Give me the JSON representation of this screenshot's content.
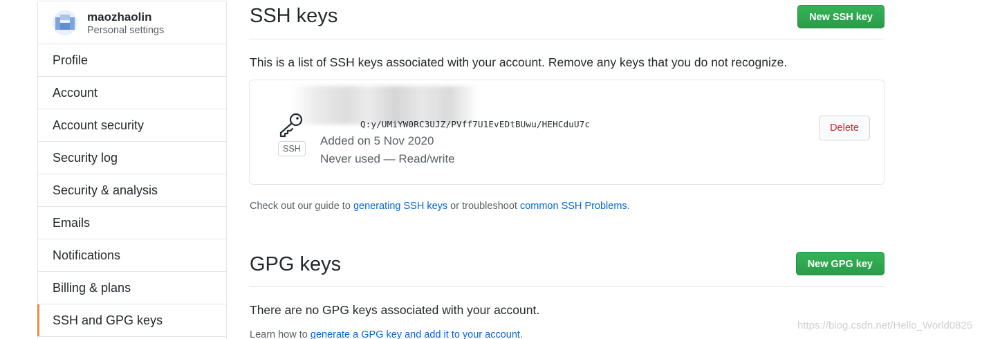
{
  "sidebar": {
    "user": {
      "name": "maozhaolin",
      "subtitle": "Personal settings"
    },
    "items": [
      {
        "label": "Profile",
        "selected": false
      },
      {
        "label": "Account",
        "selected": false
      },
      {
        "label": "Account security",
        "selected": false
      },
      {
        "label": "Security log",
        "selected": false
      },
      {
        "label": "Security & analysis",
        "selected": false
      },
      {
        "label": "Emails",
        "selected": false
      },
      {
        "label": "Notifications",
        "selected": false
      },
      {
        "label": "Billing & plans",
        "selected": false
      },
      {
        "label": "SSH and GPG keys",
        "selected": true
      }
    ]
  },
  "ssh": {
    "title": "SSH keys",
    "new_button": "New SSH key",
    "intro": "This is a list of SSH keys associated with your account. Remove any keys that you do not recognize.",
    "key": {
      "type_badge": "SSH",
      "fingerprint": "Q:y/UMiYW0RC3UJZ/PVff7U1EvEDtBUwu/HEHCduU7c",
      "added": "Added on 5 Nov 2020",
      "usage": "Never used — Read/write",
      "delete_label": "Delete"
    },
    "guide": {
      "prefix": "Check out our guide to ",
      "link1": "generating SSH keys",
      "middle": " or troubleshoot ",
      "link2": "common SSH Problems",
      "suffix": "."
    }
  },
  "gpg": {
    "title": "GPG keys",
    "new_button": "New GPG key",
    "empty": "There are no GPG keys associated with your account.",
    "learn": {
      "prefix": "Learn how to ",
      "link": "generate a GPG key and add it to your account",
      "suffix": "."
    }
  },
  "watermark": "https://blog.csdn.net/Hello_World0825",
  "colors": {
    "accent_green": "#2ea44f",
    "link_blue": "#0366d6",
    "danger_red": "#cb2431",
    "selected_marker": "#e36209"
  }
}
